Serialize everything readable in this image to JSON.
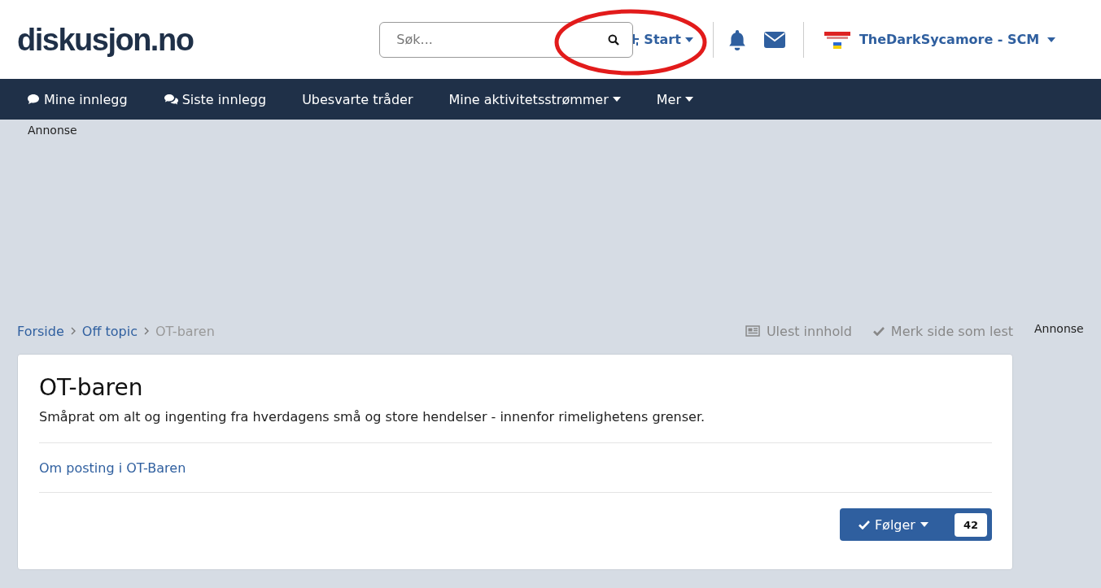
{
  "logo": "diskusjon.no",
  "search": {
    "placeholder": "Søk..."
  },
  "header_menu": {
    "label": "Start",
    "dropdown": true
  },
  "user": {
    "name": "TheDarkSycamore - SCM",
    "dropdown": true
  },
  "nav": [
    {
      "label": "Mine innlegg",
      "kind": "comment",
      "dropdown": false
    },
    {
      "label": "Siste innlegg",
      "kind": "comments",
      "dropdown": false
    },
    {
      "label": "Ubesvarte tråder",
      "kind": "text",
      "dropdown": false
    },
    {
      "label": "Mine aktivitetsstrømmer",
      "kind": "text",
      "dropdown": true
    },
    {
      "label": "Mer",
      "kind": "text",
      "dropdown": true
    }
  ],
  "ad_label_top": "Annonse",
  "ad_label_side": "Annonse",
  "breadcrumbs": [
    {
      "label": "Forside",
      "current": false
    },
    {
      "label": "Off topic",
      "current": false
    },
    {
      "label": "OT-baren",
      "current": true
    }
  ],
  "page_actions": [
    {
      "label": "Ulest innhold",
      "kind": "newspaper"
    },
    {
      "label": "Merk side som lest",
      "kind": "check"
    }
  ],
  "forum": {
    "title": "OT-baren",
    "description": "Småprat om alt og ingenting fra hverdagens små og store hendelser - innenfor rimelighetens grenser.",
    "link": "Om posting i OT-Baren"
  },
  "follow_button": {
    "label": "Følger",
    "count": "42",
    "dropdown": true
  }
}
